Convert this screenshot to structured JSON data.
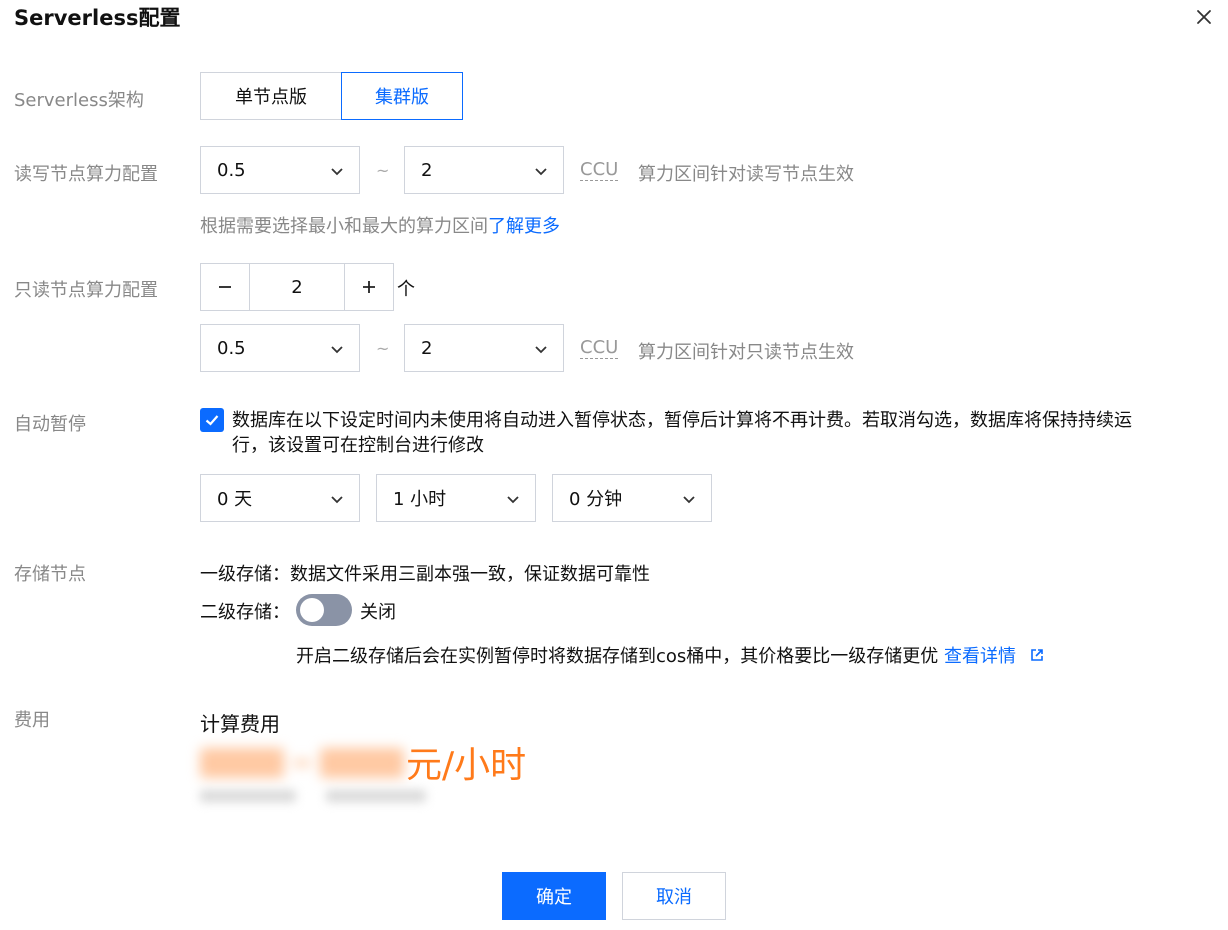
{
  "dialog": {
    "title": "Serverless配置"
  },
  "architecture": {
    "label": "Serverless架构",
    "options": [
      "单节点版",
      "集群版"
    ],
    "selected": "集群版"
  },
  "rw_compute": {
    "label": "读写节点算力配置",
    "min": "0.5",
    "max": "2",
    "tilde": "~",
    "unit": "CCU",
    "note": "算力区间针对读写节点生效",
    "hint": "根据需要选择最小和最大的算力区间",
    "hint_link": "了解更多"
  },
  "ro_compute": {
    "label": "只读节点算力配置",
    "count": "2",
    "count_unit": "个",
    "min": "0.5",
    "max": "2",
    "tilde": "~",
    "unit": "CCU",
    "note": "算力区间针对只读节点生效"
  },
  "auto_pause": {
    "label": "自动暂停",
    "checked": true,
    "text": "数据库在以下设定时间内未使用将自动进入暂停状态，暂停后计算将不再计费。若取消勾选，数据库将保持持续运行，该设置可在控制台进行修改",
    "days": "0 天",
    "hours": "1 小时",
    "minutes": "0 分钟"
  },
  "storage": {
    "label": "存储节点",
    "level1": "一级存储：数据文件采用三副本强一致，保证数据可靠性",
    "level2_label": "二级存储：",
    "level2_state": "关闭",
    "level2_on": false,
    "level2_hint": "开启二级存储后会在实例暂停时将数据存储到cos桶中，其价格要比一级存储更优",
    "level2_link": "查看详情"
  },
  "fee": {
    "label": "费用",
    "title": "计算费用",
    "price_unit": "元/小时"
  },
  "footer": {
    "confirm": "确定",
    "cancel": "取消"
  },
  "colors": {
    "accent": "#0b6bff",
    "price": "#ff7a1a",
    "toggle_off": "#8a93a6"
  }
}
